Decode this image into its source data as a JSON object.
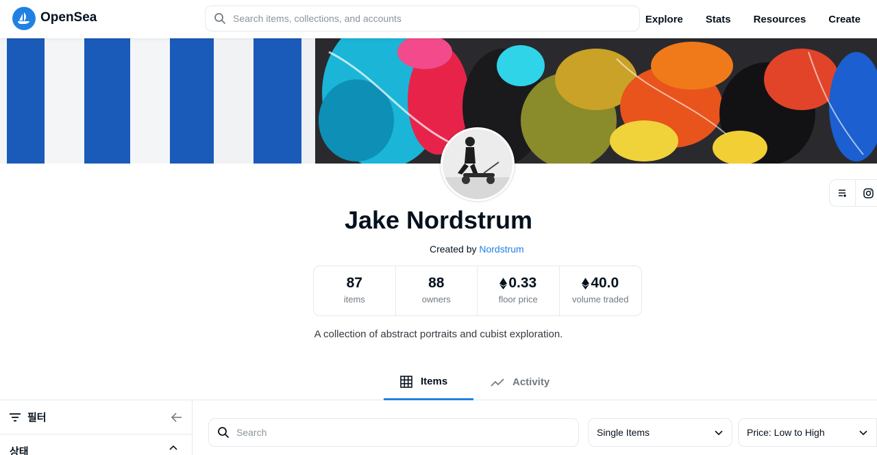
{
  "header": {
    "brand": "OpenSea",
    "search_placeholder": "Search items, collections, and accounts",
    "nav": [
      "Explore",
      "Stats",
      "Resources",
      "Create"
    ]
  },
  "collection": {
    "title": "Jake Nordstrum",
    "created_by_label": "Created by ",
    "creator": "Nordstrum",
    "stats": [
      {
        "value": "87",
        "label": "items",
        "eth": false
      },
      {
        "value": "88",
        "label": "owners",
        "eth": false
      },
      {
        "value": "0.33",
        "label": "floor price",
        "eth": true
      },
      {
        "value": "40.0",
        "label": "volume traded",
        "eth": true
      }
    ],
    "description": "A collection of abstract portraits and cubist exploration."
  },
  "tabs": {
    "items": "Items",
    "activity": "Activity"
  },
  "filter": {
    "title": "필터",
    "status": "상태"
  },
  "toolbar": {
    "search_placeholder": "Search",
    "type_select": "Single Items",
    "sort_select": "Price: Low to High"
  },
  "colors": {
    "accent": "#2081e2",
    "text": "#04111d",
    "muted": "#707a83",
    "border": "#e5e8eb"
  }
}
